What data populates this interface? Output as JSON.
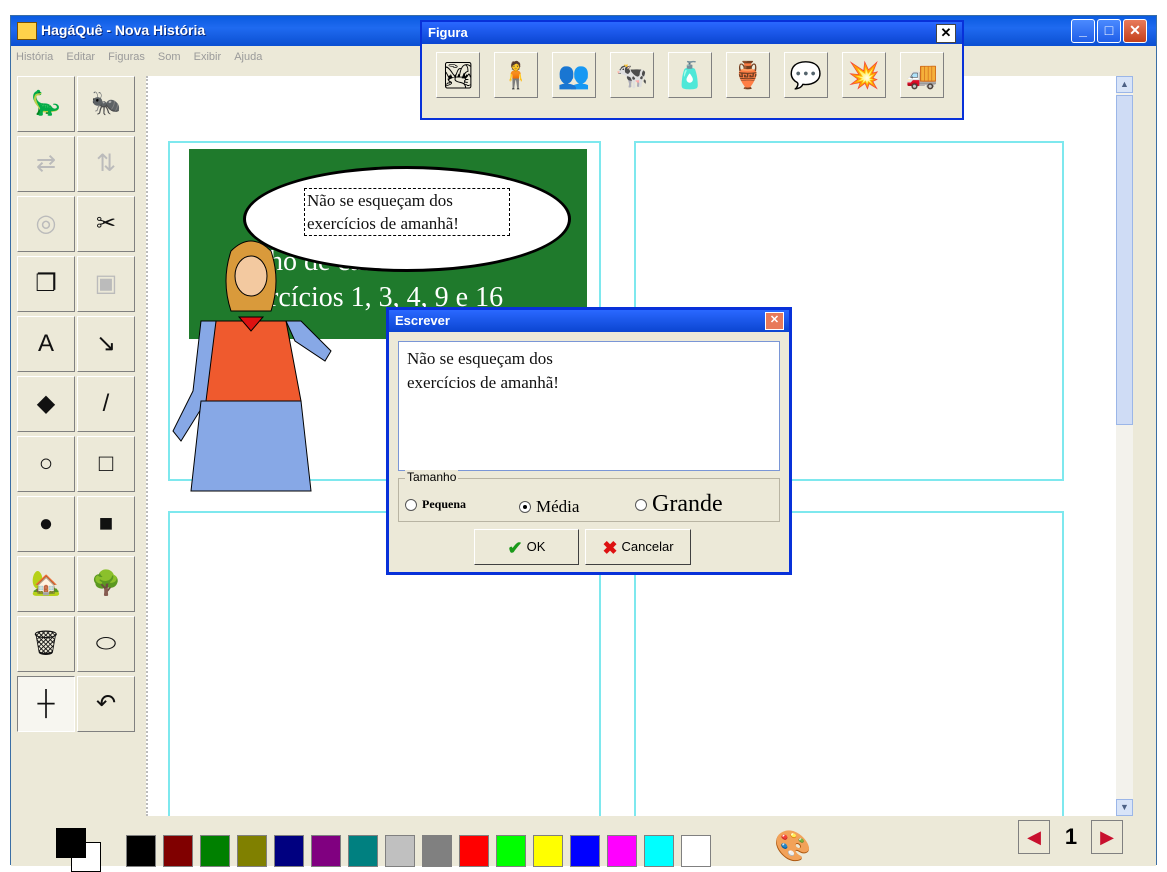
{
  "window": {
    "title": "HagáQuê - Nova História"
  },
  "menu": [
    "História",
    "Editar",
    "Figuras",
    "Som",
    "Exibir",
    "Ajuda"
  ],
  "left_toolbar": [
    {
      "name": "dinosaur-icon",
      "glyph": "🦕"
    },
    {
      "name": "ant-icon",
      "glyph": "🐜"
    },
    {
      "name": "flip-horizontal-icon",
      "glyph": "⇄",
      "disabled": true
    },
    {
      "name": "flip-vertical-icon",
      "glyph": "⇅",
      "disabled": true
    },
    {
      "name": "rotate-icon",
      "glyph": "◎",
      "disabled": true
    },
    {
      "name": "scissors-icon",
      "glyph": "✂"
    },
    {
      "name": "copy-icon",
      "glyph": "❐"
    },
    {
      "name": "paste-icon",
      "glyph": "▣",
      "disabled": true
    },
    {
      "name": "text-tool-icon",
      "glyph": "A"
    },
    {
      "name": "pen-tool-icon",
      "glyph": "↘"
    },
    {
      "name": "fill-bucket-icon",
      "glyph": "◆"
    },
    {
      "name": "line-tool-icon",
      "glyph": "/"
    },
    {
      "name": "ellipse-outline-icon",
      "glyph": "○"
    },
    {
      "name": "rectangle-outline-icon",
      "glyph": "□"
    },
    {
      "name": "ellipse-filled-icon",
      "glyph": "●"
    },
    {
      "name": "rectangle-filled-icon",
      "glyph": "■"
    },
    {
      "name": "stamp-house-icon",
      "glyph": "🏡"
    },
    {
      "name": "stamp-tree-icon",
      "glyph": "🌳"
    },
    {
      "name": "trash-icon",
      "glyph": "🗑"
    },
    {
      "name": "eraser-icon",
      "glyph": "⬭"
    },
    {
      "name": "crosshair-icon",
      "glyph": "┼",
      "pressed": true
    },
    {
      "name": "undo-icon",
      "glyph": "↶"
    }
  ],
  "canvas": {
    "board_text_1": "ho de casa:",
    "board_text_2": "rcícios 1, 3, 4, 9 e 16",
    "bubble_text": "Não se esqueçam dos exercícios de amanhã!"
  },
  "figura_toolbar": {
    "title": "Figura",
    "close": "✕",
    "buttons": [
      {
        "name": "background-scene-icon",
        "glyph": "🏞"
      },
      {
        "name": "character-icon",
        "glyph": "🧍"
      },
      {
        "name": "people-icon",
        "glyph": "👥"
      },
      {
        "name": "animals-icon",
        "glyph": "🐄"
      },
      {
        "name": "objects-bottle-icon",
        "glyph": "🧴"
      },
      {
        "name": "objects-jar-icon",
        "glyph": "🏺"
      },
      {
        "name": "speech-balloon-icon",
        "glyph": "💬"
      },
      {
        "name": "onomatopoeia-icon",
        "glyph": "💥"
      },
      {
        "name": "truck-icon",
        "glyph": "🚚"
      }
    ]
  },
  "dialog": {
    "title": "Escrever",
    "close": "✕",
    "text": "Não se esqueçam dos\nexercícios de amanhã!",
    "size_group_label": "Tamanho",
    "options": [
      {
        "label": "Pequena",
        "selected": false
      },
      {
        "label": "Média",
        "selected": true
      },
      {
        "label": "Grande",
        "selected": false
      }
    ],
    "ok_label": "OK",
    "ok_icon": "✔",
    "cancel_label": "Cancelar",
    "cancel_icon": "✖"
  },
  "palette": {
    "foreground": "#000000",
    "background": "#ffffff",
    "colors": [
      "#000000",
      "#800000",
      "#008000",
      "#808000",
      "#000080",
      "#800080",
      "#008080",
      "#c0c0c0",
      "#808080",
      "#ff0000",
      "#00ff00",
      "#ffff00",
      "#0000ff",
      "#ff00ff",
      "#00ffff",
      "#ffffff"
    ],
    "palette_icon": "🎨"
  },
  "pagination": {
    "prev": "◀",
    "page": "1",
    "next": "▶"
  }
}
